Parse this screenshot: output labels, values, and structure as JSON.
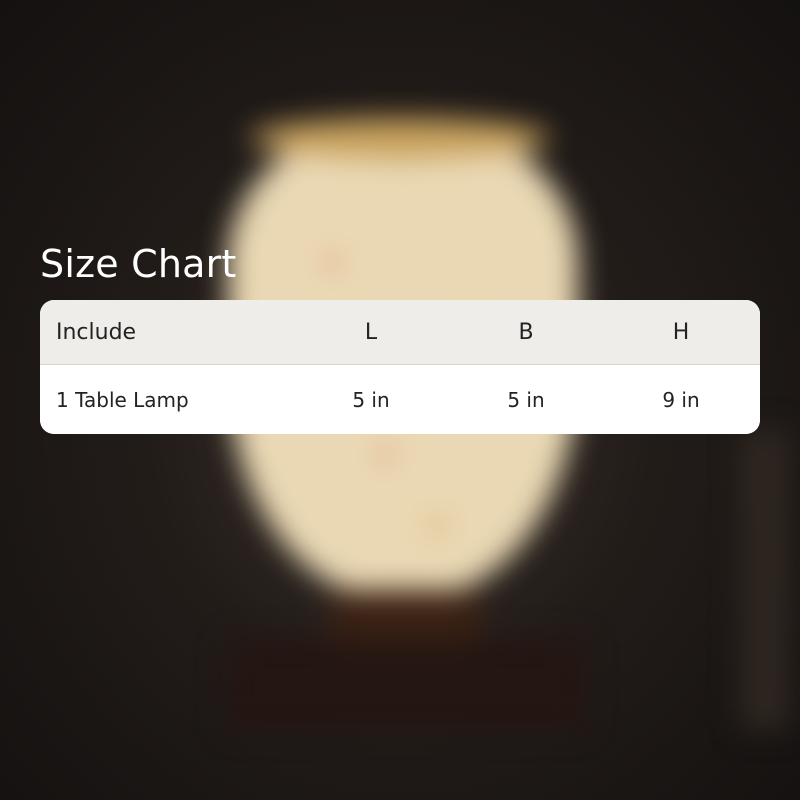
{
  "title": "Size Chart",
  "size_table": {
    "headers": [
      "Include",
      "L",
      "B",
      "H"
    ],
    "rows": [
      [
        "1 Table Lamp",
        "5 in",
        "5 in",
        "9 in"
      ]
    ]
  },
  "colors": {
    "header_row_bg": "#efedea",
    "body_row_bg": "#ffffff",
    "title_text": "#ffffff",
    "table_text": "#232323"
  }
}
